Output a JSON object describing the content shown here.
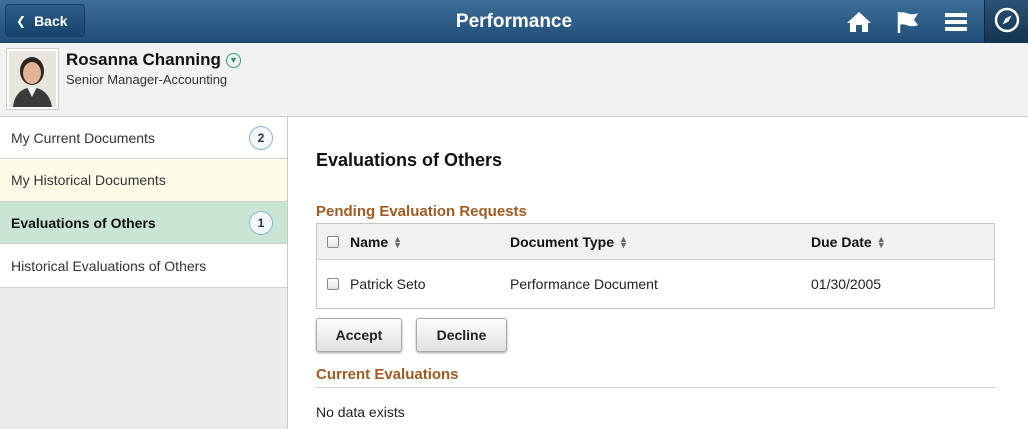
{
  "banner": {
    "back_label": "Back",
    "title": "Performance",
    "icons": [
      "home-icon",
      "flag-icon",
      "menu-icon",
      "compass-icon"
    ]
  },
  "person": {
    "name": "Rosanna Channing",
    "job_title": "Senior Manager-Accounting"
  },
  "sidebar": {
    "items": [
      {
        "label": "My Current Documents",
        "count": "2"
      },
      {
        "label": "My Historical Documents",
        "count": ""
      },
      {
        "label": "Evaluations of Others",
        "count": "1"
      },
      {
        "label": "Historical Evaluations of Others",
        "count": ""
      }
    ]
  },
  "main": {
    "title": "Evaluations of Others",
    "pending_title": "Pending Evaluation Requests",
    "columns": [
      "Name",
      "Document Type",
      "Due Date"
    ],
    "rows": [
      {
        "name": "Patrick Seto",
        "doc_type": "Performance Document",
        "due_date": "01/30/2005"
      }
    ],
    "accept_label": "Accept",
    "decline_label": "Decline",
    "current_title": "Current Evaluations",
    "no_data": "No data exists"
  },
  "colors": {
    "banner": "#2b5a85",
    "section_title": "#a05a22",
    "active_item": "#c9e6d4",
    "historical_item": "#fffde8"
  }
}
